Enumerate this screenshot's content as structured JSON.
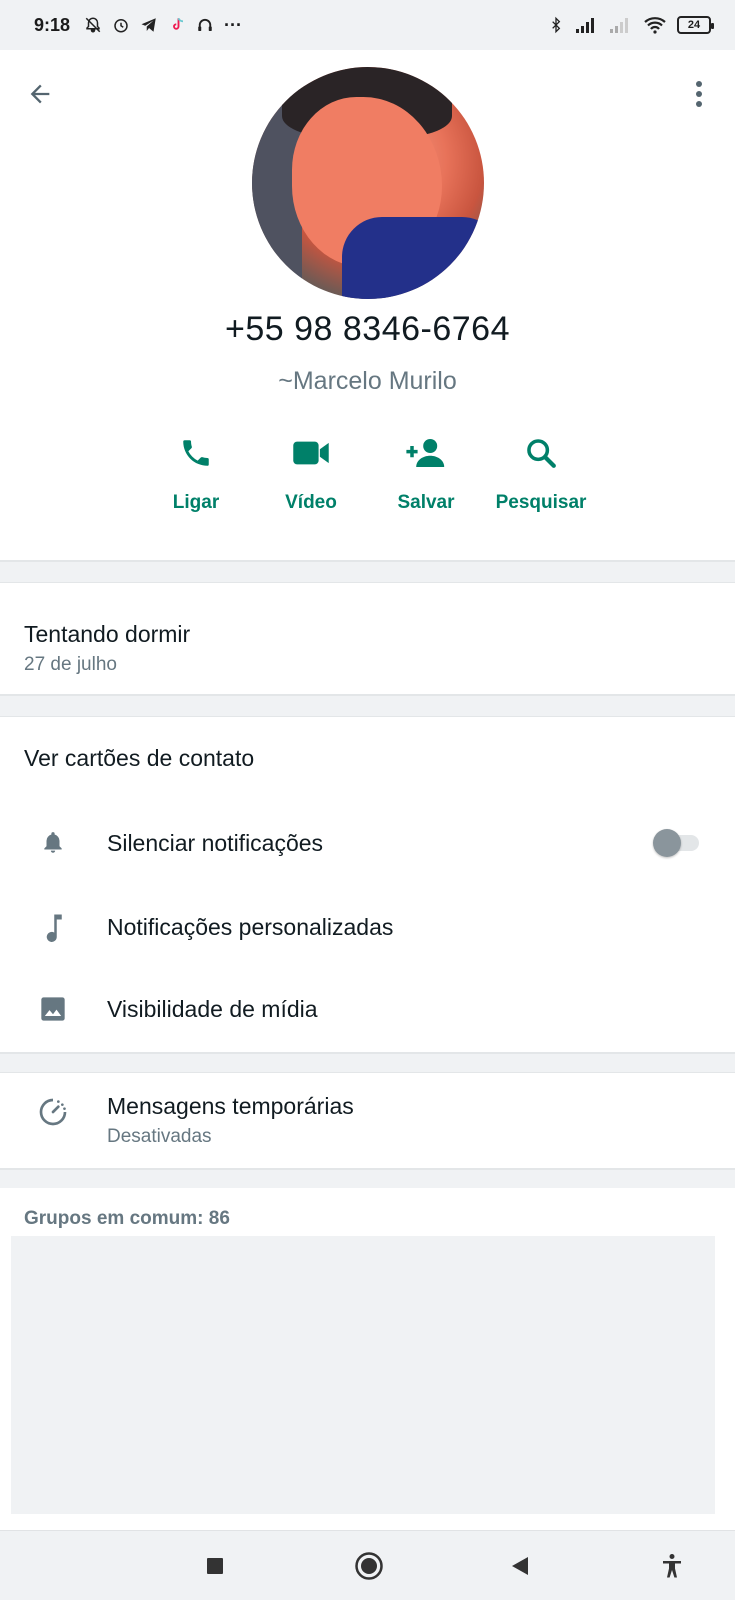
{
  "status_bar": {
    "time": "9:18",
    "more": "···",
    "battery": "24"
  },
  "colors": {
    "accent": "#008069",
    "text_primary": "#111b21",
    "text_secondary": "#667781",
    "background": "#f0f2f4"
  },
  "contact": {
    "phone": "+55 98 8346-6764",
    "pushname": "~Marcelo Murilo"
  },
  "actions": [
    {
      "label": "Ligar",
      "icon": "phone-icon"
    },
    {
      "label": "Vídeo",
      "icon": "video-icon"
    },
    {
      "label": "Salvar",
      "icon": "add-person-icon"
    },
    {
      "label": "Pesquisar",
      "icon": "search-icon"
    }
  ],
  "about": {
    "text": "Tentando dormir",
    "date": "27 de julho"
  },
  "settings": {
    "contact_cards": "Ver cartões de contato",
    "mute": "Silenciar notificações",
    "mute_enabled": false,
    "custom_notifications": "Notificações personalizadas",
    "media_visibility": "Visibilidade de mídia"
  },
  "disappearing": {
    "title": "Mensagens temporárias",
    "status": "Desativadas"
  },
  "groups": {
    "title": "Grupos em comum: 86"
  }
}
